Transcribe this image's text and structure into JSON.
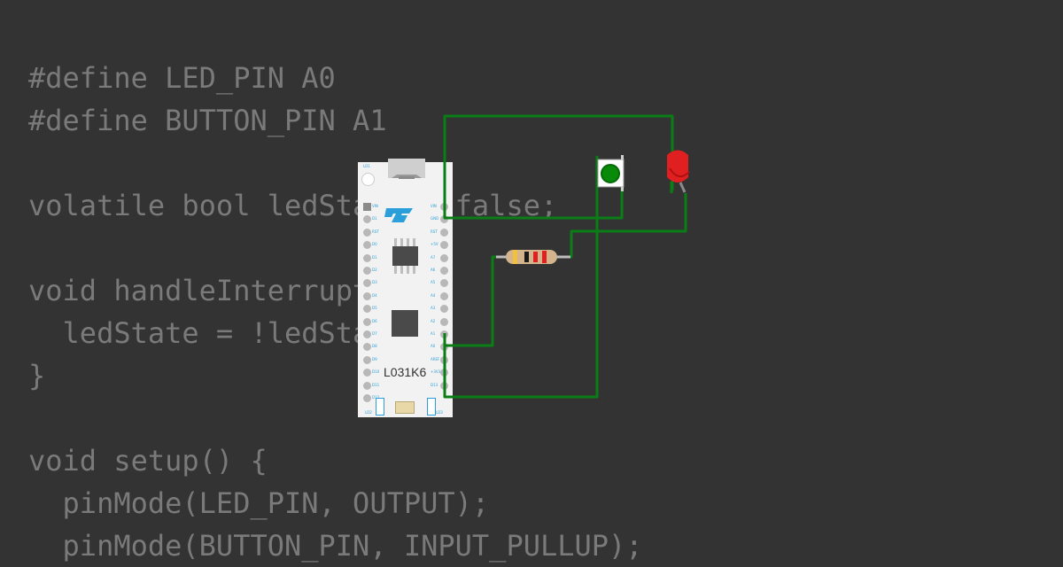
{
  "code_lines": [
    "#define LED_PIN A0",
    "#define BUTTON_PIN A1",
    "",
    "volatile bool ledState = false;",
    "",
    "void handleInterrupt() {",
    "  ledState = !ledState;",
    "}",
    "",
    "void setup() {",
    "  pinMode(LED_PIN, OUTPUT);",
    "  pinMode(BUTTON_PIN, INPUT_PULLUP);"
  ],
  "board": {
    "model": "L031K6",
    "left_pin_labels": [
      "VIN",
      "D1",
      "RST",
      "D0",
      "D1",
      "D2",
      "D3",
      "D4",
      "D5",
      "D6",
      "D7",
      "D8",
      "D9",
      "D10",
      "D11",
      "D12"
    ],
    "right_pin_labels": [
      "VIN",
      "GND",
      "RST",
      "+5V",
      "A7",
      "A6",
      "A5",
      "A4",
      "A3",
      "A2",
      "A1",
      "A0",
      "AREF",
      "+3V3",
      "D13"
    ],
    "led_labels": [
      "LD1",
      "LD2",
      "LD3"
    ]
  },
  "colors": {
    "background": "#333333",
    "code_text": "#7a7a7a",
    "wire": "#0a7d14",
    "button_cap": "#0a8a0a",
    "led": "#e02020",
    "board": "#f2f2f2",
    "st_logo": "#2b9fd9"
  },
  "icons": [
    "st-logo-icon",
    "usb-connector-icon"
  ]
}
